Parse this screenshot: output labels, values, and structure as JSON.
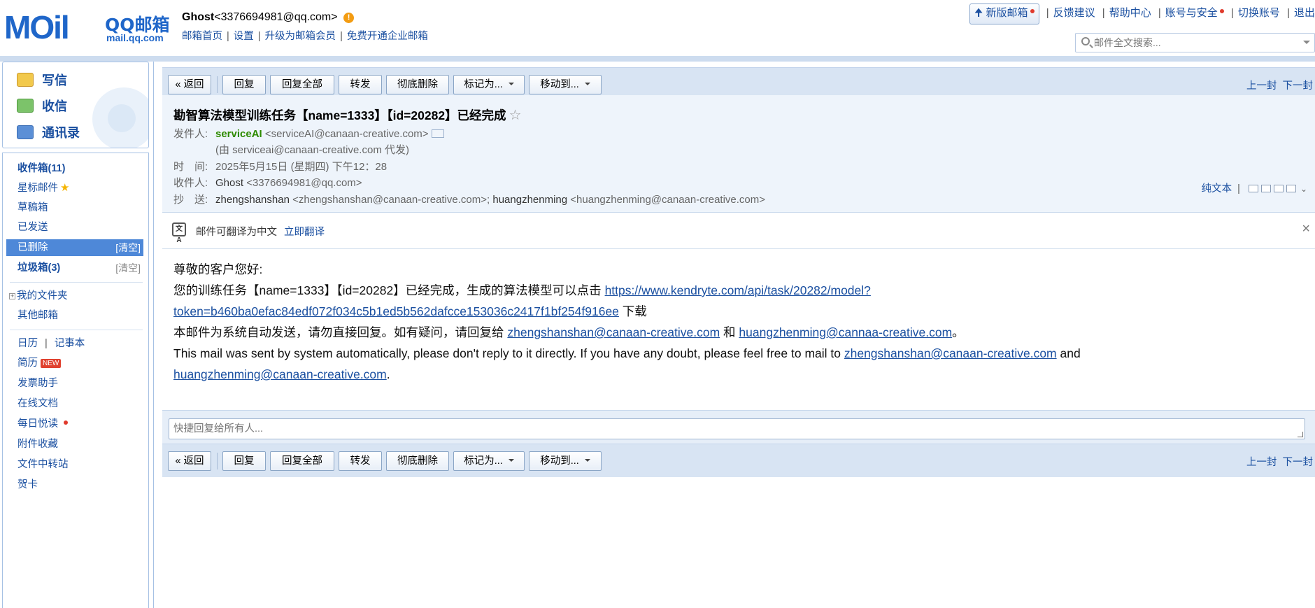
{
  "header": {
    "logo_main": "MOil",
    "logo_qq": "QQ邮箱",
    "logo_domain": "mail.qq.com",
    "user_name": "Ghost",
    "user_email": "<3376694981@qq.com>",
    "links": [
      "邮箱首页",
      "设置",
      "升级为邮箱会员",
      "免费开通企业邮箱"
    ],
    "right_links": {
      "new_box": "新版邮箱",
      "feedback": "反馈建议",
      "help": "帮助中心",
      "account": "账号与安全",
      "switch": "切换账号",
      "logout": "退出"
    },
    "search_placeholder": "邮件全文搜索..."
  },
  "sidebar": {
    "compose": "写信",
    "inbox_check": "收信",
    "contacts": "通讯录",
    "folders": [
      {
        "label": "收件箱(11)",
        "bold": true
      },
      {
        "label": "星标邮件"
      },
      {
        "label": "草稿箱"
      },
      {
        "label": "已发送"
      },
      {
        "label": "已删除",
        "clear": "[清空]",
        "selected": true
      },
      {
        "label": "垃圾箱(3)",
        "clear": "[清空]",
        "bold": true
      }
    ],
    "my_folders": "我的文件夹",
    "other_mailbox": "其他邮箱",
    "calendar": "日历",
    "notes": "记事本",
    "resume": "简历",
    "new_badge": "NEW",
    "tools": [
      "发票助手",
      "在线文档",
      "每日悦读",
      "附件收藏",
      "文件中转站",
      "贺卡"
    ]
  },
  "toolbar": {
    "back": "« 返回",
    "reply": "回复",
    "reply_all": "回复全部",
    "forward": "转发",
    "delete_perm": "彻底删除",
    "mark_as": "标记为...",
    "move_to": "移动到...",
    "prev": "上一封",
    "next": "下一封"
  },
  "email": {
    "subject": "勘智算法模型训练任务【name=1333】【id=20282】已经完成",
    "from_label": "发件人:",
    "from_name": "serviceAI",
    "from_email": "<serviceAI@canaan-creative.com>",
    "on_behalf": "(由 serviceai@canaan-creative.com 代发)",
    "time_label": "时　间:",
    "time": "2025年5月15日 (星期四) 下午12：28",
    "to_label": "收件人:",
    "to_name": "Ghost",
    "to_email": "<3376694981@qq.com>",
    "cc_label": "抄　送:",
    "cc1_name": "zhengshanshan",
    "cc1_email": "<zhengshanshan@canaan-creative.com>;",
    "cc2_name": "huangzhenming",
    "cc2_email": "<huangzhenming@canaan-creative.com>",
    "plain_text": "纯文本"
  },
  "translate": {
    "icon": "文A",
    "text": "邮件可翻译为中文",
    "action": "立即翻译"
  },
  "body": {
    "greeting": "尊敬的客户您好:",
    "line1_pre": "您的训练任务【name=1333】【id=20282】已经完成，生成的算法模型可以点击",
    "link1_a": "https://www.kendryte.com/api/task/20282/model?",
    "link1_b": "token=b460ba0efac84edf072f034c5b1ed5b562dafcce153036c2417f1bf254f916ee",
    "line1_post": "下载",
    "line2_pre": "本邮件为系统自动发送，请勿直接回复。如有疑问，请回复给",
    "line2_link1": "zhengshanshan@canaan-creative.com",
    "line2_mid": "和",
    "line2_link2": "huangzhenming@cannaa-creative.com",
    "line2_post": "。",
    "line3_pre": "This mail was sent by system automatically, please don't reply to it directly. If you have any doubt, please feel free to mail to",
    "line3_link1": "zhengshanshan@canaan-creative.com",
    "line3_mid": "and",
    "line3_link2": "huangzhenming@canaan-creative.com",
    "line3_post": "."
  },
  "quick_reply": {
    "placeholder": "快捷回复给所有人..."
  },
  "colors": {
    "brand_blue": "#1f66c9",
    "link": "#1a4fa0",
    "selected": "#4e88d8",
    "sender_green": "#2e8b00"
  }
}
